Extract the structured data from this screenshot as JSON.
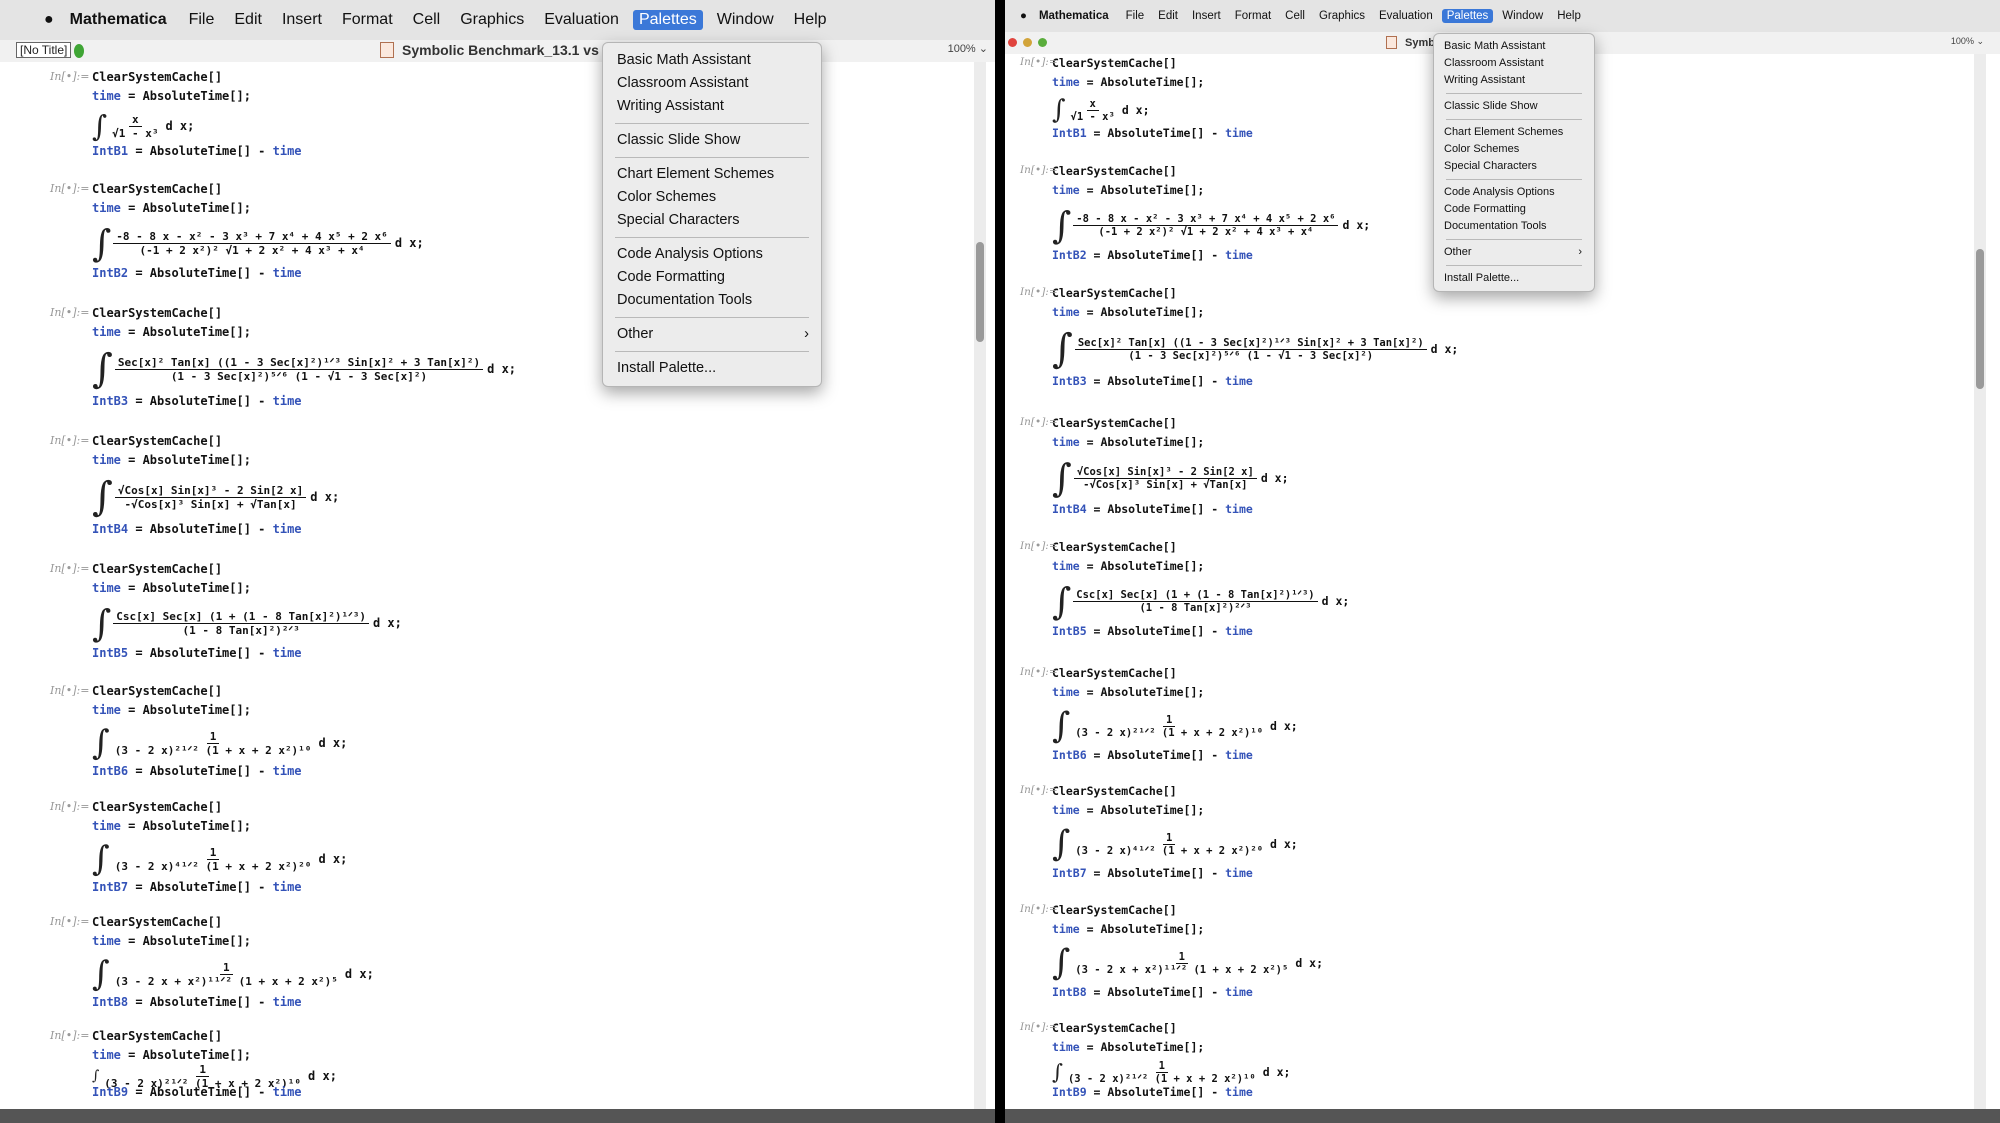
{
  "menubar": {
    "app": "Mathematica",
    "items": [
      "File",
      "Edit",
      "Insert",
      "Format",
      "Cell",
      "Graphics",
      "Evaluation",
      "Palettes",
      "Window",
      "Help"
    ],
    "active": "Palettes"
  },
  "left_window": {
    "no_title_label": "[No Title]",
    "doc_title": "Symbolic Benchmark_13.1 vs 13",
    "zoom": "100%"
  },
  "right_window": {
    "doc_title": "Symb",
    "zoom": "100%"
  },
  "palettes_menu": {
    "groups": [
      [
        "Basic Math Assistant",
        "Classroom Assistant",
        "Writing Assistant"
      ],
      [
        "Classic Slide Show"
      ],
      [
        "Chart Element Schemes",
        "Color Schemes",
        "Special Characters"
      ],
      [
        "Code Analysis Options",
        "Code Formatting",
        "Documentation Tools"
      ],
      [
        "Other"
      ],
      [
        "Install Palette..."
      ]
    ],
    "submenu_arrow": "›"
  },
  "cells": {
    "in_label": "In[•]:=",
    "clear": "ClearSystemCache[]",
    "time_kw": "time",
    "time_rest": " = AbsoluteTime[];",
    "int_sign": "∫",
    "dx": "d x;",
    "items": [
      {
        "name": "IntB1",
        "num": "x",
        "den": "√1 - x³"
      },
      {
        "name": "IntB2",
        "num": "-8 - 8 x - x² - 3 x³ + 7 x⁴ + 4 x⁵ + 2 x⁶",
        "den": "(-1 + 2 x²)² √1 + 2 x² + 4 x³ + x⁴"
      },
      {
        "name": "IntB3",
        "num": "Sec[x]² Tan[x] ((1 - 3 Sec[x]²)¹ᐟ³ Sin[x]² + 3 Tan[x]²)",
        "den": "(1 - 3 Sec[x]²)⁵ᐟ⁶ (1 - √1 - 3 Sec[x]²)"
      },
      {
        "name": "IntB4",
        "num": "√Cos[x] Sin[x]³ - 2 Sin[2 x]",
        "den": "-√Cos[x]³ Sin[x] + √Tan[x]"
      },
      {
        "name": "IntB5",
        "num": "Csc[x] Sec[x] (1 + (1 - 8 Tan[x]²)¹ᐟ³)",
        "den": "(1 - 8 Tan[x]²)²ᐟ³"
      },
      {
        "name": "IntB6",
        "num": "1",
        "den": "(3 - 2 x)²¹ᐟ² (1 + x + 2 x²)¹⁰"
      },
      {
        "name": "IntB7",
        "num": "1",
        "den": "(3 - 2 x)⁴¹ᐟ² (1 + x + 2 x²)²⁰"
      },
      {
        "name": "IntB8",
        "num": "1",
        "den": "(3 - 2 x + x²)¹¹ᐟ² (1 + x + 2 x²)⁵"
      },
      {
        "name": "IntB9",
        "num": "1",
        "den": "(3 - 2 x)²¹ᐟ² (1 + x + 2 x²)¹⁰"
      }
    ],
    "eq_rest": " = AbsoluteTime[] - "
  }
}
